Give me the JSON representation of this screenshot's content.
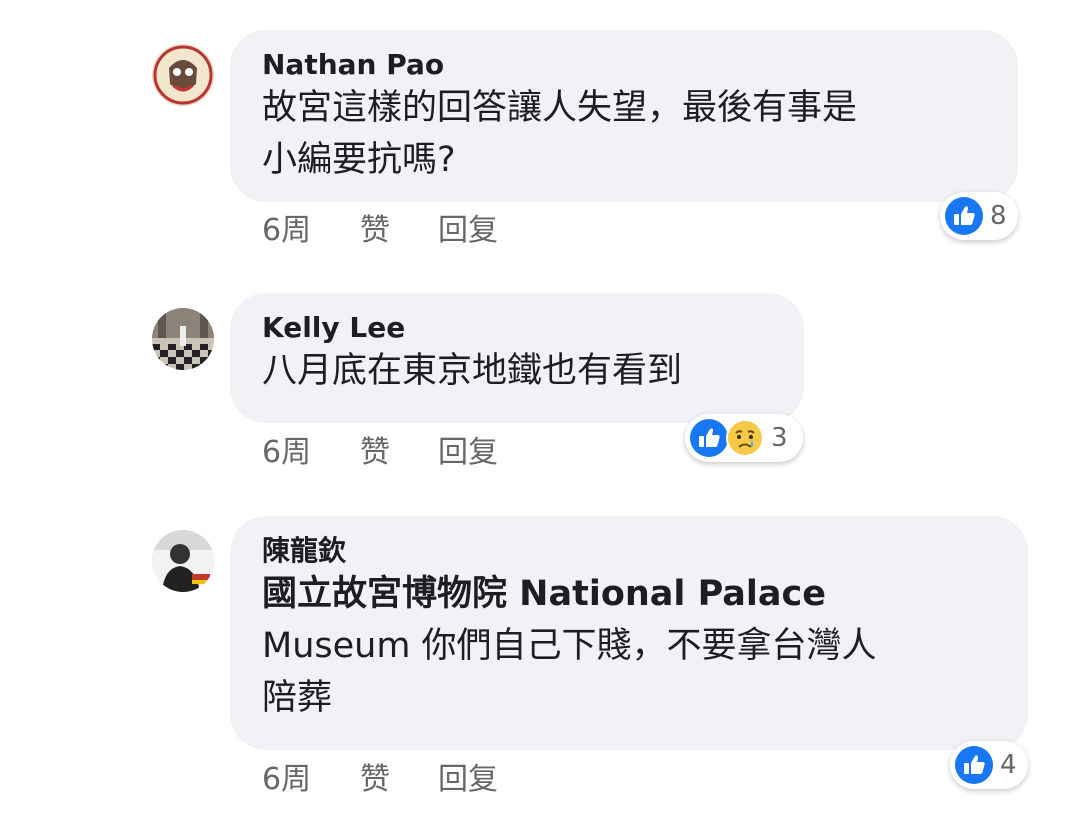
{
  "comments": [
    {
      "author": "Nathan Pao",
      "lines": [
        "故宮這樣的回答讓人失望，最後有事是",
        "小編要抗嗎?"
      ],
      "time": "6周",
      "like_label": "赞",
      "reply_label": "回复",
      "reaction_count": "8",
      "reactions": [
        "like-icon"
      ]
    },
    {
      "author": "Kelly Lee",
      "lines": [
        "八月底在東京地鐵也有看到"
      ],
      "time": "6周",
      "like_label": "赞",
      "reply_label": "回复",
      "reaction_count": "3",
      "reactions": [
        "like-icon",
        "sad-icon"
      ]
    },
    {
      "author": "陳龍欽",
      "lines": [
        "國立故宮博物院 National Palace",
        "Museum 你們自己下賤，不要拿台灣人",
        "陪葬"
      ],
      "time": "6周",
      "like_label": "赞",
      "reply_label": "回复",
      "reaction_count": "4",
      "reactions": [
        "like-icon"
      ]
    }
  ],
  "colors": {
    "bubble": "#f0f2f5",
    "like_blue": "#1877f2",
    "meta_gray": "#65676b"
  }
}
